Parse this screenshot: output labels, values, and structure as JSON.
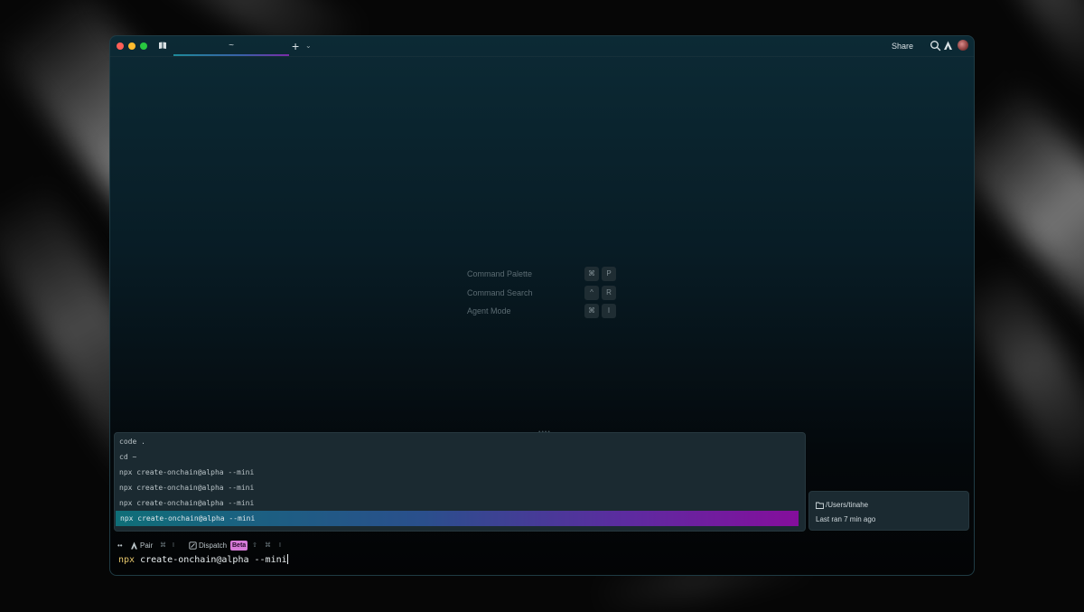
{
  "window": {
    "tab": {
      "title": "~"
    },
    "header": {
      "share_label": "Share"
    }
  },
  "shortcuts": [
    {
      "label": "Command Palette",
      "keys": [
        "⌘",
        "P"
      ]
    },
    {
      "label": "Command Search",
      "keys": [
        "^",
        "R"
      ]
    },
    {
      "label": "Agent Mode",
      "keys": [
        "⌘",
        "I"
      ]
    }
  ],
  "history": {
    "items": [
      "code .",
      "cd ~",
      "npx create-onchain@alpha --mini",
      "npx create-onchain@alpha --mini",
      "npx create-onchain@alpha --mini",
      "npx create-onchain@alpha --mini"
    ],
    "selected_index": 5
  },
  "detail": {
    "path": "/Users/tinahe",
    "last_ran": "Last ran 7 min ago"
  },
  "toolbar": {
    "pair_label": "Pair",
    "pair_keys": [
      "⌘",
      "I"
    ],
    "dispatch_label": "Dispatch",
    "beta_badge": "Beta",
    "dispatch_keys": [
      "⇧",
      "⌘",
      "I"
    ]
  },
  "input": {
    "command": "npx",
    "args": " create-onchain@alpha --mini"
  },
  "colors": {
    "selection_gradient": [
      "#0f6e78",
      "#850e9c"
    ],
    "beta_badge": "#d67ad8",
    "command_highlight": "#e6c76c"
  }
}
